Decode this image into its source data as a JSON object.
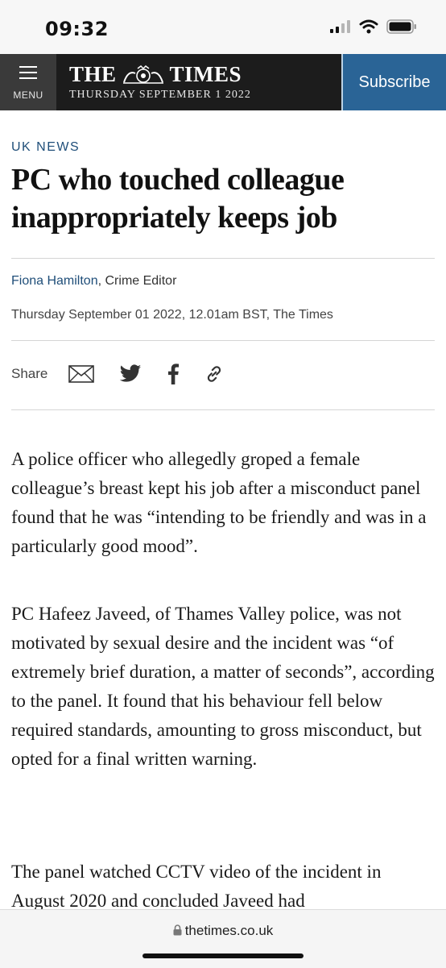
{
  "status_bar": {
    "time": "09:32"
  },
  "masthead": {
    "menu_label": "MENU",
    "logo_left": "THE",
    "logo_right": "TIMES",
    "date": "THURSDAY SEPTEMBER 1 2022",
    "subscribe_label": "Subscribe"
  },
  "article": {
    "section": "UK NEWS",
    "headline": "PC who touched colleague inappropriately keeps job",
    "author": "Fiona Hamilton",
    "author_role": ", Crime Editor",
    "dateline": "Thursday September 01 2022, 12.01am BST, The Times",
    "share_label": "Share",
    "paragraphs": [
      "A police officer who allegedly groped a female colleague’s breast kept his job after a misconduct panel found that he was “intending to be friendly and was in a particularly good mood”.",
      "PC Hafeez Javeed, of Thames Valley police, was not motivated by sexual desire and the incident was “of extremely brief duration, a matter of seconds”, according to the panel. It found that his behaviour fell below required standards, amounting to gross misconduct, but opted for a final written warning.",
      "The panel watched CCTV video of the incident in August 2020 and concluded Javeed had"
    ]
  },
  "browser": {
    "url": "thetimes.co.uk"
  }
}
